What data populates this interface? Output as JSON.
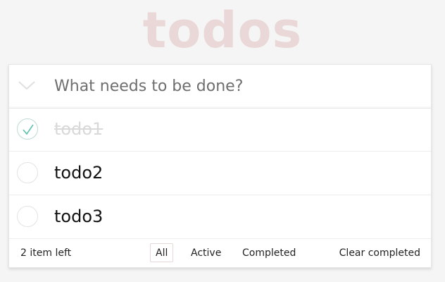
{
  "app": {
    "title": "todos"
  },
  "new_todo": {
    "placeholder": "What needs to be done?",
    "value": ""
  },
  "todos": [
    {
      "label": "todo1",
      "completed": true
    },
    {
      "label": "todo2",
      "completed": false
    },
    {
      "label": "todo3",
      "completed": false
    }
  ],
  "footer": {
    "count_text": "2 item left",
    "filters": [
      "All",
      "Active",
      "Completed"
    ],
    "selected_filter": "All",
    "clear_label": "Clear completed"
  },
  "icons": {
    "toggle_all": "chevron-down-icon",
    "completed_check": "checkmark-icon"
  },
  "colors": {
    "title": "#ead7d7",
    "check_mark": "#5dc2af",
    "completed_text": "#d9d9d9"
  }
}
